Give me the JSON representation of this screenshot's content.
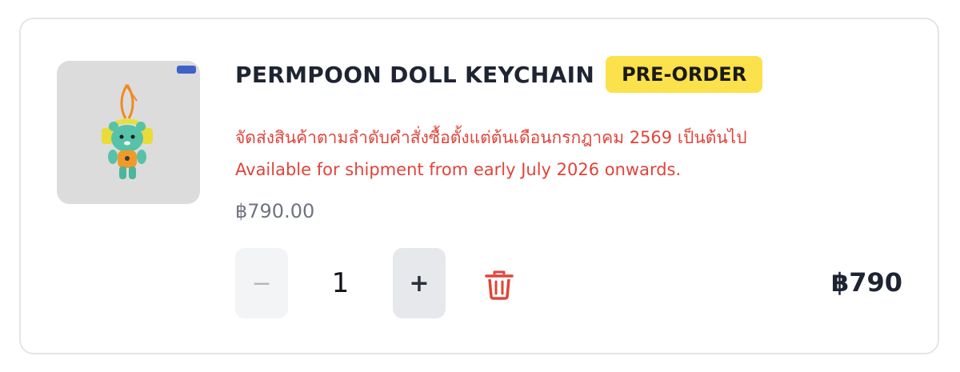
{
  "item": {
    "name": "PERMPOON DOLL KEYCHAIN",
    "badge": "PRE-ORDER",
    "shipping_note_th": "จัดส่งสินค้าตามลำดับคำสั่งซื้อตั้งแต่ต้นเดือนกรกฎาคม 2569 เป็นต้นไป",
    "shipping_note_en": "Available for shipment from early July 2026 onwards.",
    "unit_price": "฿790.00",
    "total": "฿790",
    "image_icon": "teal-cat-doll-keychain-image"
  },
  "quantity": {
    "decrement_label": "−",
    "value": "1",
    "increment_label": "+"
  },
  "actions": {
    "delete_icon": "trash-icon"
  },
  "colors": {
    "badge_bg": "#fbe14b",
    "note_text": "#e0443a",
    "title_text": "#1f2433",
    "price_text": "#6f7480",
    "delete_icon": "#e0443a"
  }
}
